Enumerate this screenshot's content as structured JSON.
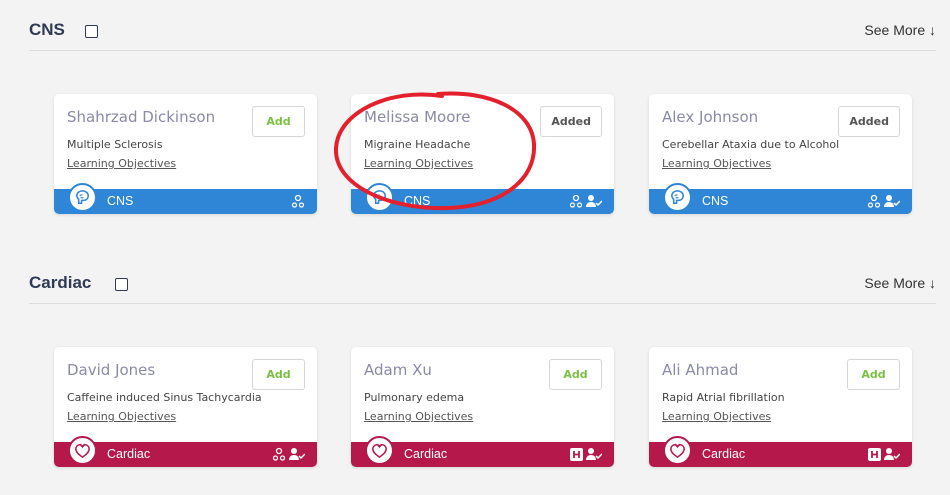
{
  "sections": [
    {
      "title": "CNS",
      "see_more": "See More ↓",
      "cards": [
        {
          "name": "Shahrzad Dickinson",
          "diagnosis": "Multiple Sclerosis",
          "learning_objectives": "Learning Objectives",
          "button": "Add",
          "system": "CNS",
          "tags": [
            "group-icon"
          ]
        },
        {
          "name": "Melissa Moore",
          "diagnosis": "Migraine Headache",
          "learning_objectives": "Learning Objectives",
          "button": "Added",
          "system": "CNS",
          "tags": [
            "group-icon",
            "user-check-icon"
          ]
        },
        {
          "name": "Alex Johnson",
          "diagnosis": "Cerebellar Ataxia due to Alcohol",
          "learning_objectives": "Learning Objectives",
          "button": "Added",
          "system": "CNS",
          "tags": [
            "group-icon",
            "user-check-icon"
          ]
        }
      ]
    },
    {
      "title": "Cardiac",
      "see_more": "See More ↓",
      "cards": [
        {
          "name": "David Jones",
          "diagnosis": "Caffeine induced Sinus Tachycardia",
          "learning_objectives": "Learning Objectives",
          "button": "Add",
          "system": "Cardiac",
          "tags": [
            "group-icon",
            "user-check-icon"
          ]
        },
        {
          "name": "Adam Xu",
          "diagnosis": "Pulmonary edema",
          "learning_objectives": "Learning Objectives",
          "button": "Add",
          "system": "Cardiac",
          "tags": [
            "hospital-icon",
            "user-check-icon"
          ]
        },
        {
          "name": "Ali Ahmad",
          "diagnosis": "Rapid Atrial fibrillation",
          "learning_objectives": "Learning Objectives",
          "button": "Add",
          "system": "Cardiac",
          "tags": [
            "hospital-icon",
            "user-check-icon"
          ]
        }
      ]
    }
  ],
  "colors": {
    "cns": "#2f86d6",
    "cardiac": "#b5194b",
    "add": "#7ac142",
    "annotation": "#e3202c"
  }
}
